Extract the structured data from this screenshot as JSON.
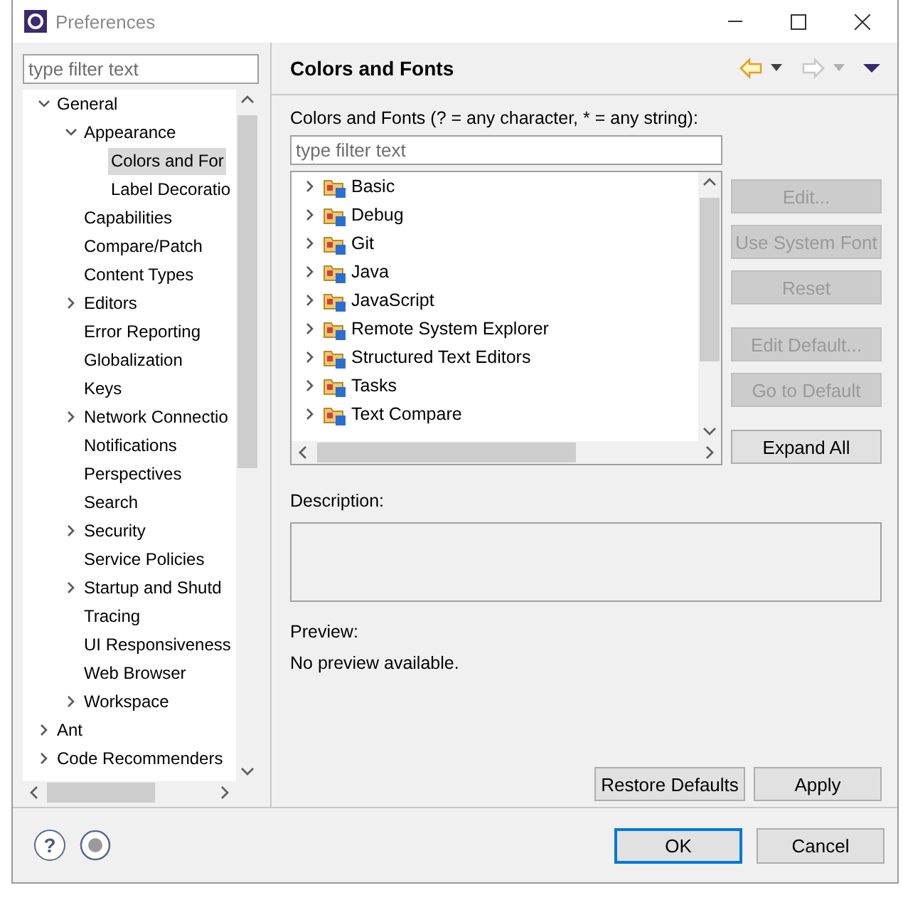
{
  "window": {
    "title": "Preferences"
  },
  "sidebar": {
    "filter": {
      "placeholder": "type filter text"
    },
    "items": [
      {
        "label": "General",
        "expanded": true,
        "selected": false,
        "children": [
          {
            "label": "Appearance",
            "expanded": true,
            "selected": false,
            "children": [
              {
                "label": "Colors and For",
                "selected": true
              },
              {
                "label": "Label Decoratio",
                "selected": false
              }
            ]
          },
          {
            "label": "Capabilities",
            "selected": false
          },
          {
            "label": "Compare/Patch",
            "selected": false
          },
          {
            "label": "Content Types",
            "selected": false
          },
          {
            "label": "Editors",
            "expanded": false,
            "selected": false
          },
          {
            "label": "Error Reporting",
            "selected": false
          },
          {
            "label": "Globalization",
            "selected": false
          },
          {
            "label": "Keys",
            "selected": false
          },
          {
            "label": "Network Connectio",
            "expanded": false,
            "selected": false
          },
          {
            "label": "Notifications",
            "selected": false
          },
          {
            "label": "Perspectives",
            "selected": false
          },
          {
            "label": "Search",
            "selected": false
          },
          {
            "label": "Security",
            "expanded": false,
            "selected": false
          },
          {
            "label": "Service Policies",
            "selected": false
          },
          {
            "label": "Startup and Shutd",
            "expanded": false,
            "selected": false
          },
          {
            "label": "Tracing",
            "selected": false
          },
          {
            "label": "UI Responsiveness",
            "selected": false
          },
          {
            "label": "Web Browser",
            "selected": false
          },
          {
            "label": "Workspace",
            "expanded": false,
            "selected": false
          }
        ]
      },
      {
        "label": "Ant",
        "expanded": false,
        "selected": false
      },
      {
        "label": "Code Recommenders",
        "expanded": false,
        "selected": false
      }
    ]
  },
  "page": {
    "title": "Colors and Fonts",
    "nav": {
      "back_disabled": false,
      "forward_disabled": true
    },
    "filter_label": "Colors and Fonts (? = any character, * = any string):",
    "filter": {
      "placeholder": "type filter text"
    },
    "categories": [
      {
        "label": "Basic",
        "expanded": false
      },
      {
        "label": "Debug",
        "expanded": false
      },
      {
        "label": "Git",
        "expanded": false
      },
      {
        "label": "Java",
        "expanded": false
      },
      {
        "label": "JavaScript",
        "expanded": false
      },
      {
        "label": "Remote System Explorer",
        "expanded": false
      },
      {
        "label": "Structured Text Editors",
        "expanded": false
      },
      {
        "label": "Tasks",
        "expanded": false
      },
      {
        "label": "Text Compare",
        "expanded": false
      }
    ],
    "side_button_groups": [
      [
        {
          "label": "Edit...",
          "disabled": true
        },
        {
          "label": "Use System Font",
          "disabled": true
        },
        {
          "label": "Reset",
          "disabled": true
        }
      ],
      [
        {
          "label": "Edit Default...",
          "disabled": true
        },
        {
          "label": "Go to Default",
          "disabled": true
        }
      ],
      [
        {
          "label": "Expand All",
          "disabled": false
        }
      ]
    ],
    "description_label": "Description:",
    "preview_label": "Preview:",
    "preview_text": "No preview available.",
    "buttons": [
      "Restore Defaults",
      "Apply"
    ]
  },
  "footer": {
    "help": "?",
    "buttons": [
      {
        "label": "OK",
        "default": true
      },
      {
        "label": "Cancel",
        "default": false
      }
    ]
  }
}
